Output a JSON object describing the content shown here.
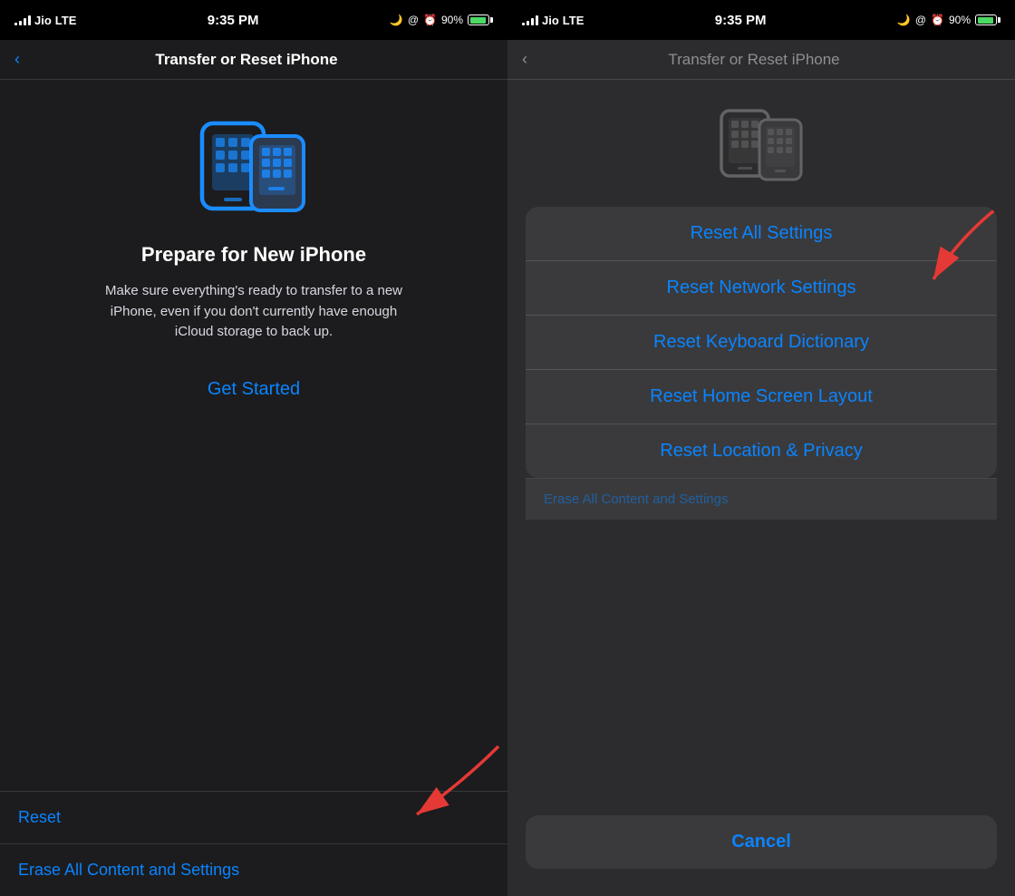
{
  "left": {
    "statusBar": {
      "carrier": "Jio",
      "network": "LTE",
      "time": "9:35 PM",
      "battery": "90%"
    },
    "navTitle": "Transfer or Reset iPhone",
    "transferIcon": "phones-transfer",
    "prepareTitle": "Prepare for New iPhone",
    "prepareDesc": "Make sure everything's ready to transfer to a new iPhone, even if you don't currently have enough iCloud storage to back up.",
    "getStartedLabel": "Get Started",
    "resetLabel": "Reset",
    "eraseLabel": "Erase All Content and Settings"
  },
  "right": {
    "statusBar": {
      "carrier": "Jio",
      "network": "LTE",
      "time": "9:35 PM",
      "battery": "90%"
    },
    "navTitle": "Transfer or Reset iPhone",
    "resetIcon": "phones-gray",
    "sheetItems": [
      {
        "label": "Reset All Settings"
      },
      {
        "label": "Reset Network Settings"
      },
      {
        "label": "Reset Keyboard Dictionary"
      },
      {
        "label": "Reset Home Screen Layout"
      },
      {
        "label": "Reset Location & Privacy"
      }
    ],
    "eraseLabel": "Erase All Content and Settings",
    "cancelLabel": "Cancel"
  }
}
